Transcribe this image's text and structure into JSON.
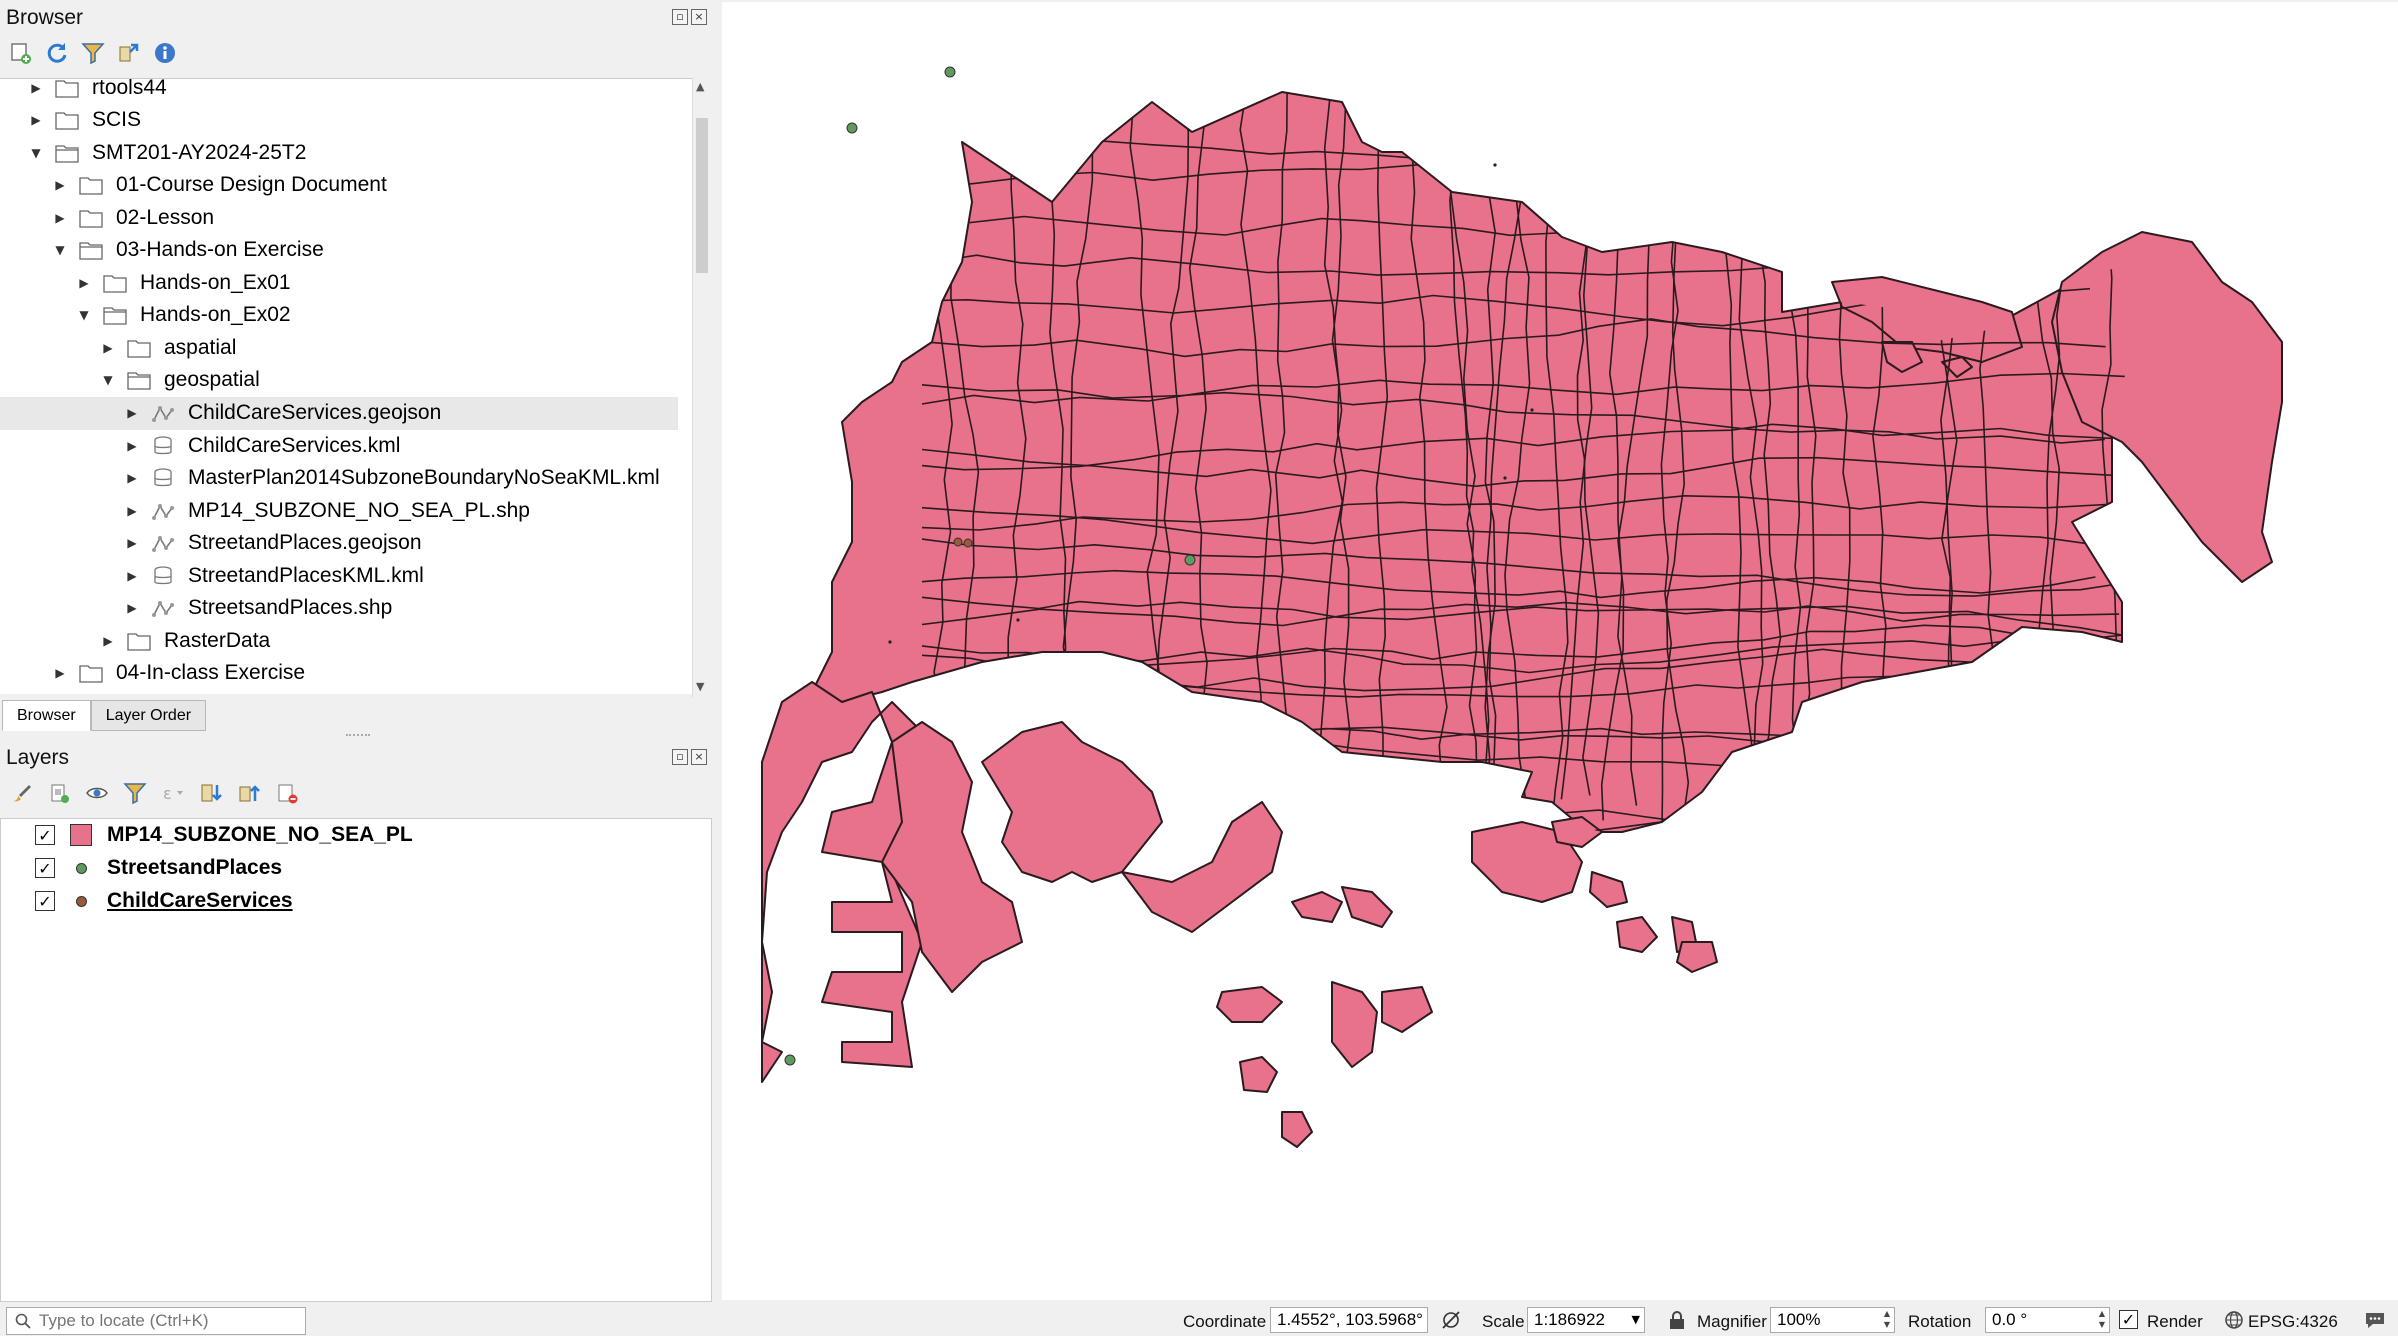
{
  "browser": {
    "title": "Browser",
    "toolbar": [
      "add-layer-icon",
      "refresh-icon",
      "filter-icon",
      "collapse-all-icon",
      "properties-info-icon"
    ],
    "items": [
      {
        "label": "rtools44",
        "type": "folder",
        "expanded": false,
        "level": 0
      },
      {
        "label": "SCIS",
        "type": "folder",
        "expanded": false,
        "level": 0
      },
      {
        "label": "SMT201-AY2024-25T2",
        "type": "folder",
        "expanded": true,
        "level": 0
      },
      {
        "label": "01-Course Design Document",
        "type": "folder",
        "expanded": false,
        "level": 1
      },
      {
        "label": "02-Lesson",
        "type": "folder",
        "expanded": false,
        "level": 1
      },
      {
        "label": "03-Hands-on Exercise",
        "type": "folder",
        "expanded": true,
        "level": 1
      },
      {
        "label": "Hands-on_Ex01",
        "type": "folder",
        "expanded": false,
        "level": 2
      },
      {
        "label": "Hands-on_Ex02",
        "type": "folder",
        "expanded": true,
        "level": 2
      },
      {
        "label": "aspatial",
        "type": "folder",
        "expanded": false,
        "level": 3
      },
      {
        "label": "geospatial",
        "type": "folder",
        "expanded": true,
        "level": 3
      },
      {
        "label": "ChildCareServices.geojson",
        "type": "vector",
        "expanded": false,
        "level": 4,
        "selected": true
      },
      {
        "label": "ChildCareServices.kml",
        "type": "database",
        "expanded": false,
        "level": 4
      },
      {
        "label": "MasterPlan2014SubzoneBoundaryNoSeaKML.kml",
        "type": "database",
        "expanded": false,
        "level": 4
      },
      {
        "label": "MP14_SUBZONE_NO_SEA_PL.shp",
        "type": "vector",
        "expanded": false,
        "level": 4
      },
      {
        "label": "StreetandPlaces.geojson",
        "type": "vector",
        "expanded": false,
        "level": 4
      },
      {
        "label": "StreetandPlacesKML.kml",
        "type": "database",
        "expanded": false,
        "level": 4
      },
      {
        "label": "StreetsandPlaces.shp",
        "type": "vector",
        "expanded": false,
        "level": 4
      },
      {
        "label": "RasterData",
        "type": "folder",
        "expanded": false,
        "level": 3
      },
      {
        "label": "04-In-class Exercise",
        "type": "folder",
        "expanded": false,
        "level": 1
      }
    ]
  },
  "tabs": [
    {
      "label": "Browser",
      "active": true
    },
    {
      "label": "Layer Order",
      "active": false
    }
  ],
  "layers": {
    "title": "Layers",
    "toolbar": [
      "style-brush-icon",
      "add-group-icon",
      "visibility-eye-icon",
      "filter-legend-icon",
      "filter-expression-icon",
      "expand-all-icon",
      "collapse-all-icon",
      "remove-layer-icon"
    ],
    "items": [
      {
        "name": "MP14_SUBZONE_NO_SEA_PL",
        "checked": true,
        "symbol": "polygon",
        "color": "#e8718c"
      },
      {
        "name": "StreetsandPlaces",
        "checked": true,
        "symbol": "point",
        "color": "#5f9a5f"
      },
      {
        "name": "ChildCareServices",
        "checked": true,
        "symbol": "point",
        "color": "#9a5a3a",
        "underline": true
      }
    ]
  },
  "status": {
    "locate_placeholder": "Type to locate (Ctrl+K)",
    "coordinate_label": "Coordinate",
    "coordinate_value": "1.4552°, 103.5968°",
    "scale_label": "Scale",
    "scale_value": "1:186922",
    "magnifier_label": "Magnifier",
    "magnifier_value": "100%",
    "rotation_label": "Rotation",
    "rotation_value": "0.0 °",
    "render_label": "Render",
    "render_checked": true,
    "crs": "EPSG:4326"
  },
  "map": {
    "fill_color": "#e8718c",
    "stroke_color": "#2b1a1e",
    "point_green": "#5f9a5f",
    "point_brown": "#9a5a3a"
  }
}
